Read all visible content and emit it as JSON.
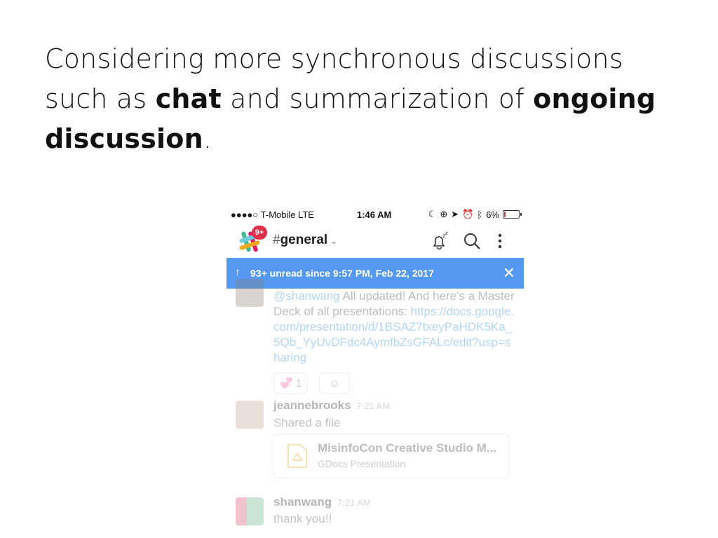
{
  "slide": {
    "line1": "Considering more synchronous discussions",
    "line2_pre": "such as ",
    "line2_bold1": "chat",
    "line2_mid": " and summarization of ",
    "line2_bold2": "ongoing",
    "line3_bold": "discussion",
    "line3_post": "."
  },
  "status_bar": {
    "carrier": "●●●●○ T-Mobile  LTE",
    "time": "1:46 AM",
    "battery": "6%",
    "icons": [
      "moon-icon",
      "rotation-lock-icon",
      "location-icon",
      "alarm-icon",
      "bluetooth-icon",
      "battery-icon"
    ]
  },
  "header": {
    "badge": "9+",
    "hash": "#",
    "channel": "general",
    "icons": [
      "slack-logo-icon",
      "snooze-bell-icon",
      "search-icon",
      "more-icon"
    ]
  },
  "banner": {
    "text": "93+ unread since 9:57 PM, Feb 22, 2017",
    "arrow": "↑",
    "close": "✕"
  },
  "messages": [
    {
      "mention": "@shanwang",
      "text": " All updated! And here's a Master Deck of all presentations: ",
      "link": "https://docs.google.com/presentation/d/1BSAZ7txeyPaHDK5Ka_5Qb_YyUvDFdc4AymfbZsGFALc/edit?usp=sharing",
      "reaction_count": "1"
    },
    {
      "author": "jeannebrooks",
      "time": "7:21 AM",
      "text": "Shared a file",
      "file_title": "MisinfoCon Creative Studio M...",
      "file_type": "GDocs Presentation"
    },
    {
      "author": "shanwang",
      "time": "7:21 AM",
      "text": "thank you!!"
    }
  ],
  "colors": {
    "banner": "#5598f2",
    "badge": "#e0314b",
    "link": "#1a7fd6"
  }
}
